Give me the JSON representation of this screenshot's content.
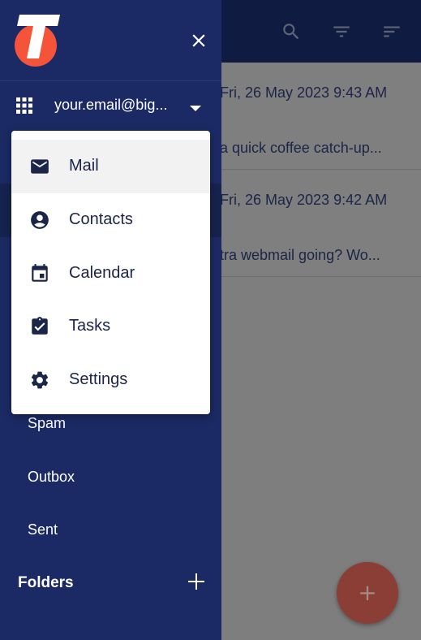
{
  "header": {
    "icons": [
      "search-icon",
      "filter-icon",
      "sort-icon"
    ]
  },
  "emails": [
    {
      "date": "Fri, 26 May 2023 9:43 AM",
      "snippet": "a quick coffee catch-up..."
    },
    {
      "date": "Fri, 26 May 2023 9:42 AM",
      "snippet": "tra webmail going? Wo..."
    }
  ],
  "drawer": {
    "account_email": "your.email@big...",
    "items": {
      "spam": "Spam",
      "outbox": "Outbox",
      "sent": "Sent"
    },
    "folders_label": "Folders"
  },
  "menu": {
    "items": [
      {
        "label": "Mail",
        "icon": "mail-icon"
      },
      {
        "label": "Contacts",
        "icon": "contacts-icon"
      },
      {
        "label": "Calendar",
        "icon": "calendar-icon"
      },
      {
        "label": "Tasks",
        "icon": "tasks-icon"
      },
      {
        "label": "Settings",
        "icon": "settings-icon"
      }
    ]
  },
  "fab": {
    "label": "+"
  },
  "colors": {
    "drawer": "#1b2a64",
    "accent": "#e4422e",
    "header": "#101b42",
    "logo_orange": "#f5543a"
  }
}
